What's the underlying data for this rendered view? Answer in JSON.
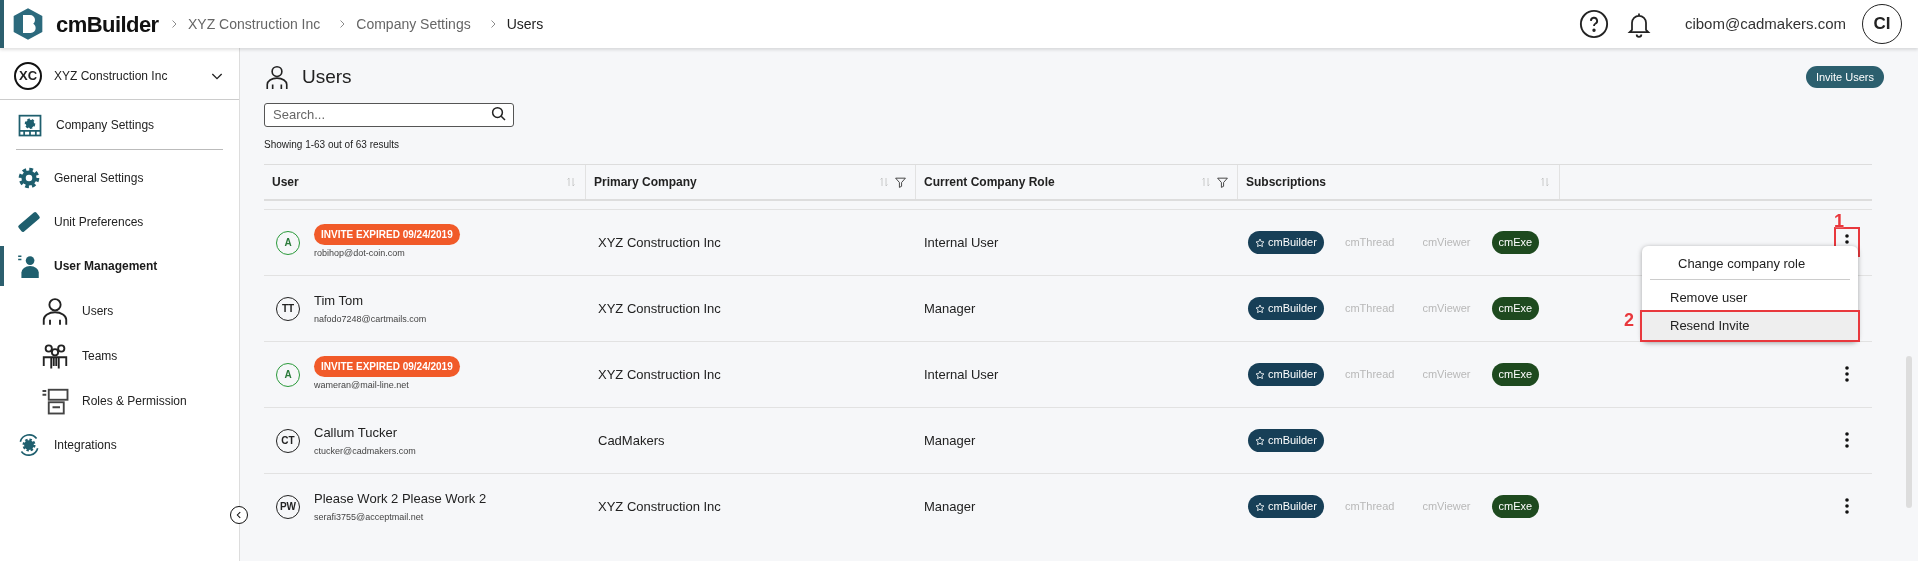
{
  "header": {
    "logo": "cmBuilder",
    "breadcrumbs": [
      "XYZ Construction Inc",
      "Company Settings",
      "Users"
    ],
    "user_email": "cibom@cadmakers.com",
    "avatar": "CI"
  },
  "sidebar": {
    "company": {
      "initials": "XC",
      "name": "XYZ Construction Inc"
    },
    "heading": "Company Settings",
    "items": [
      {
        "label": "General Settings",
        "kind": "gear",
        "selected": false
      },
      {
        "label": "Unit Preferences",
        "kind": "ruler",
        "selected": false
      },
      {
        "label": "User Management",
        "kind": "person",
        "selected": true,
        "children": [
          {
            "label": "Users",
            "kind": "user",
            "selected": false
          },
          {
            "label": "Teams",
            "kind": "team",
            "selected": false
          },
          {
            "label": "Roles & Permission",
            "kind": "roles",
            "selected": false
          }
        ]
      },
      {
        "label": "Integrations",
        "kind": "sync",
        "selected": false
      }
    ]
  },
  "page": {
    "title": "Users",
    "invite_button": "Invite Users",
    "search": {
      "placeholder": "Search..."
    },
    "results": "Showing 1-63 out of 63 results"
  },
  "table": {
    "columns": [
      {
        "label": "User",
        "filter": false
      },
      {
        "label": "Primary Company",
        "filter": true
      },
      {
        "label": "Current Company Role",
        "filter": true
      },
      {
        "label": "Subscriptions",
        "filter": false
      }
    ],
    "rows": [
      {
        "initials": "A",
        "badge": "INVITE EXPIRED 09/24/2019",
        "name": null,
        "email": "robihop@dot-coin.com",
        "company": "XYZ Construction Inc",
        "role": "Internal User",
        "menu_open": true,
        "callout": "1",
        "subscriptions": [
          {
            "label": "cmBuilder",
            "active": true,
            "starred": true,
            "color": "#173f57"
          },
          {
            "label": "cmThread",
            "active": false,
            "starred": false
          },
          {
            "label": "cmViewer",
            "active": false,
            "starred": false
          },
          {
            "label": "cmExe",
            "active": true,
            "starred": false,
            "color": "#1e4a1f"
          }
        ]
      },
      {
        "initials": "TT",
        "badge": null,
        "name": "Tim Tom",
        "email": "nafodo7248@cartmails.com",
        "company": "XYZ Construction Inc",
        "role": "Manager",
        "menu_open": false,
        "subscriptions": [
          {
            "label": "cmBuilder",
            "active": true,
            "starred": true,
            "color": "#173f57"
          },
          {
            "label": "cmThread",
            "active": false,
            "starred": false
          },
          {
            "label": "cmViewer",
            "active": false,
            "starred": false
          },
          {
            "label": "cmExe",
            "active": true,
            "starred": false,
            "color": "#1e4a1f"
          }
        ]
      },
      {
        "initials": "A",
        "badge": "INVITE EXPIRED 09/24/2019",
        "name": null,
        "email": "wameran@mail-line.net",
        "company": "XYZ Construction Inc",
        "role": "Internal User",
        "menu_open": false,
        "subscriptions": [
          {
            "label": "cmBuilder",
            "active": true,
            "starred": true,
            "color": "#173f57"
          },
          {
            "label": "cmThread",
            "active": false,
            "starred": false
          },
          {
            "label": "cmViewer",
            "active": false,
            "starred": false
          },
          {
            "label": "cmExe",
            "active": true,
            "starred": false,
            "color": "#1e4a1f"
          }
        ]
      },
      {
        "initials": "CT",
        "badge": null,
        "name": "Callum Tucker",
        "email": "ctucker@cadmakers.com",
        "company": "CadMakers",
        "role": "Manager",
        "menu_open": false,
        "subscriptions": [
          {
            "label": "cmBuilder",
            "active": true,
            "starred": true,
            "color": "#173f57"
          }
        ]
      },
      {
        "initials": "PW",
        "badge": null,
        "name": "Please Work 2 Please Work 2",
        "email": "serafi3755@acceptmail.net",
        "company": "XYZ Construction Inc",
        "role": "Manager",
        "menu_open": false,
        "subscriptions": [
          {
            "label": "cmBuilder",
            "active": true,
            "starred": true,
            "color": "#173f57"
          },
          {
            "label": "cmThread",
            "active": false,
            "starred": false
          },
          {
            "label": "cmViewer",
            "active": false,
            "starred": false
          },
          {
            "label": "cmExe",
            "active": true,
            "starred": false,
            "color": "#1e4a1f"
          }
        ]
      }
    ]
  },
  "row_menu": {
    "items": [
      {
        "label": "Change company role",
        "hovered": false
      },
      {
        "label": "Remove user",
        "hovered": false
      },
      {
        "label": "Resend Invite",
        "hovered": true,
        "callout": "2"
      }
    ]
  }
}
